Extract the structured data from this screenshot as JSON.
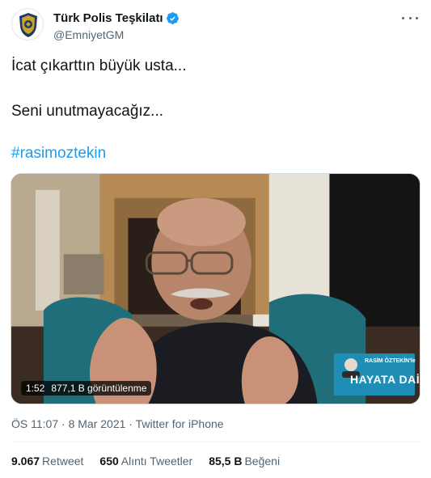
{
  "account": {
    "display_name": "Türk Polis Teşkilatı",
    "handle": "@EmniyetGM",
    "avatar_icon": "police-badge-icon",
    "verified_icon": "verified-badge-icon"
  },
  "tweet": {
    "line1": "İcat çıkarttın büyük usta...",
    "line2": "Seni unutmayacağız...",
    "hashtag": "#rasimoztekin"
  },
  "video": {
    "duration": "1:52",
    "views": "877,1 B görüntülenme",
    "overlay_small": "RASİM ÖZTEKİN'le",
    "overlay_big": "HAYATA DAİR"
  },
  "meta": {
    "time": "ÖS 11:07",
    "date": "8 Mar 2021",
    "source": "Twitter for iPhone",
    "sep": "·"
  },
  "stats": {
    "retweets_count": "9.067",
    "retweets_label": "Retweet",
    "quotes_count": "650",
    "quotes_label": "Alıntı Tweetler",
    "likes_count": "85,5 B",
    "likes_label": "Beğeni"
  },
  "colors": {
    "link": "#1d9bf0",
    "verified": "#1d9bf0",
    "muted": "#536471"
  }
}
